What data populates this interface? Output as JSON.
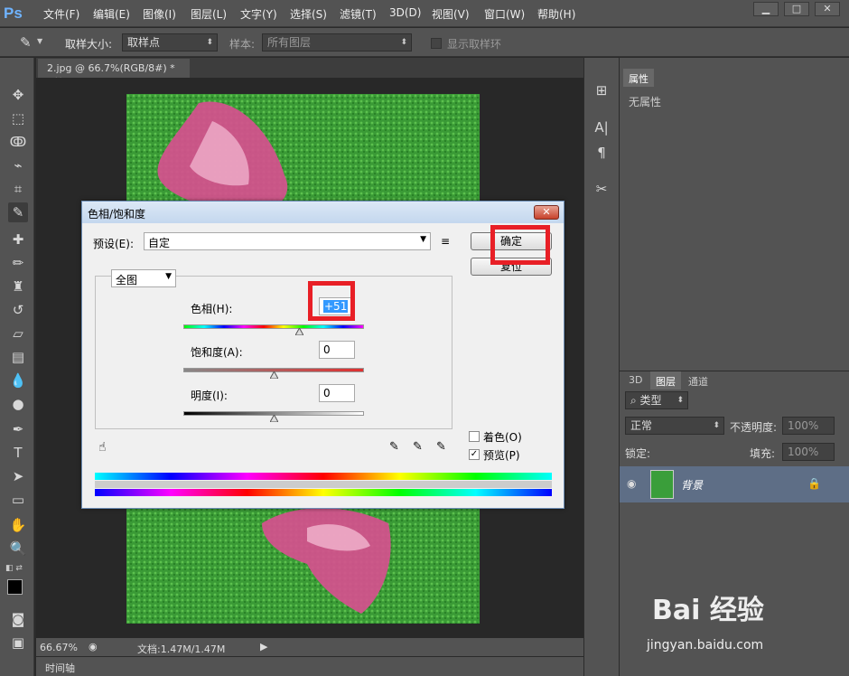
{
  "app": {
    "logo": "Ps"
  },
  "menu": [
    "文件(F)",
    "编辑(E)",
    "图像(I)",
    "图层(L)",
    "文字(Y)",
    "选择(S)",
    "滤镜(T)",
    "3D(D)",
    "视图(V)",
    "窗口(W)",
    "帮助(H)"
  ],
  "options": {
    "sample_size_label": "取样大小:",
    "sample_size_value": "取样点",
    "sample_label": "样本:",
    "sample_value": "所有图层",
    "show_ring_label": "显示取样环"
  },
  "document": {
    "tab_label": "2.jpg @ 66.7%(RGB/8#) *",
    "zoom": "66.67%",
    "doc_size": "文档:1.47M/1.47M",
    "timeline_label": "时间轴"
  },
  "properties": {
    "tab_label": "属性",
    "empty_text": "无属性"
  },
  "layers": {
    "tabs": [
      "3D",
      "图层",
      "通道"
    ],
    "filter_kind": "类型",
    "blend_mode": "正常",
    "opacity_label": "不透明度:",
    "opacity_value": "100%",
    "lock_label": "锁定:",
    "fill_label": "填充:",
    "fill_value": "100%",
    "layer_name": "背景"
  },
  "dialog": {
    "title": "色相/饱和度",
    "preset_label": "预设(E):",
    "preset_value": "自定",
    "channel": "全图",
    "hue_label": "色相(H):",
    "hue_value": "+51",
    "hue_fraction": 0.64,
    "saturation_label": "饱和度(A):",
    "saturation_value": "0",
    "lightness_label": "明度(I):",
    "lightness_value": "0",
    "ok_label": "确定",
    "reset_label": "复位",
    "colorize_label": "着色(O)",
    "preview_label": "预览(P)",
    "colorize_checked": false,
    "preview_checked": true
  },
  "watermark": {
    "brand": "Bai  经验",
    "url": "jingyan.baidu.com"
  }
}
